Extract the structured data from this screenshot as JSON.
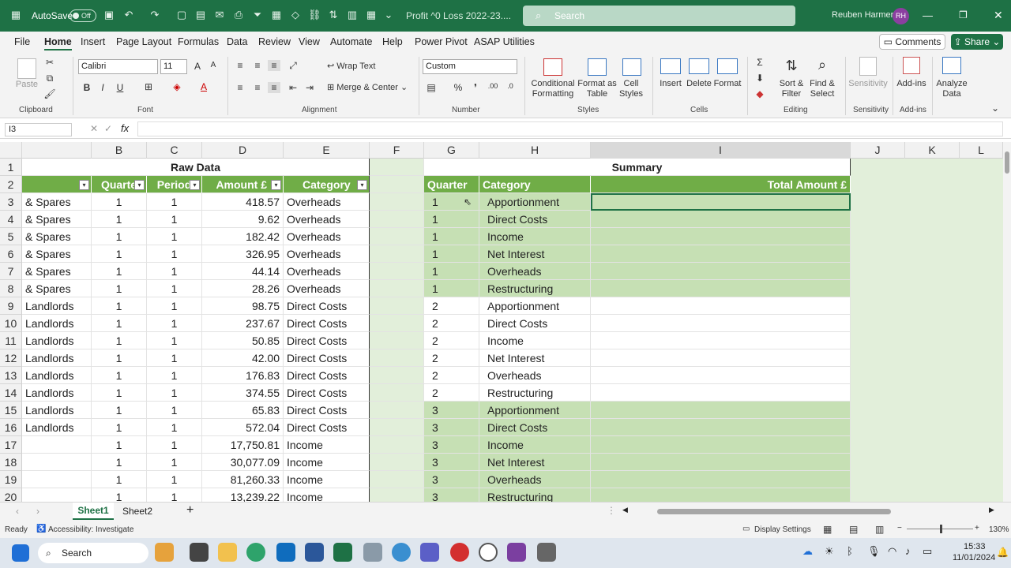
{
  "titlebar": {
    "autosave": "AutoSave",
    "toggle": "Off",
    "filename": "Profit ^0 Loss 2022-23....",
    "search_placeholder": "Search",
    "user": "Reuben Harmer",
    "initials": "RH"
  },
  "menu": [
    "File",
    "Home",
    "Insert",
    "Page Layout",
    "Formulas",
    "Data",
    "Review",
    "View",
    "Automate",
    "Help",
    "Power Pivot",
    "ASAP Utilities"
  ],
  "buttons": {
    "comments": "Comments",
    "share": "Share"
  },
  "ribbon": {
    "clipboard": {
      "paste": "Paste",
      "group": "Clipboard"
    },
    "font": {
      "name": "Calibri",
      "size": "11",
      "group": "Font"
    },
    "alignment": {
      "wrap": "Wrap Text",
      "merge": "Merge & Center",
      "group": "Alignment"
    },
    "number": {
      "format": "Custom",
      "group": "Number"
    },
    "styles": {
      "cond": "Conditional Formatting",
      "table": "Format as Table",
      "cell": "Cell Styles",
      "group": "Styles"
    },
    "cells": {
      "insert": "Insert",
      "delete": "Delete",
      "format": "Format",
      "group": "Cells"
    },
    "editing": {
      "sort": "Sort & Filter",
      "find": "Find & Select",
      "group": "Editing"
    },
    "sensitivity": {
      "label": "Sensitivity",
      "group": "Sensitivity"
    },
    "addins": {
      "label": "Add-ins",
      "group": "Add-ins"
    },
    "analyze": {
      "label": "Analyze Data"
    }
  },
  "namebox": "I3",
  "fx": "fx",
  "columns": [
    "B",
    "C",
    "D",
    "E",
    "F",
    "G",
    "H",
    "I",
    "J",
    "K",
    "L"
  ],
  "raw": {
    "title": "Raw Data",
    "headers": [
      "Quarte",
      "Period",
      "Amount £",
      "Category"
    ],
    "rows": [
      [
        "& Spares",
        "1",
        "1",
        "418.57",
        "Overheads"
      ],
      [
        "& Spares",
        "1",
        "1",
        "9.62",
        "Overheads"
      ],
      [
        "& Spares",
        "1",
        "1",
        "182.42",
        "Overheads"
      ],
      [
        "& Spares",
        "1",
        "1",
        "326.95",
        "Overheads"
      ],
      [
        "& Spares",
        "1",
        "1",
        "44.14",
        "Overheads"
      ],
      [
        "& Spares",
        "1",
        "1",
        "28.26",
        "Overheads"
      ],
      [
        "Landlords",
        "1",
        "1",
        "98.75",
        "Direct Costs"
      ],
      [
        "Landlords",
        "1",
        "1",
        "237.67",
        "Direct Costs"
      ],
      [
        "Landlords",
        "1",
        "1",
        "50.85",
        "Direct Costs"
      ],
      [
        "Landlords",
        "1",
        "1",
        "42.00",
        "Direct Costs"
      ],
      [
        "Landlords",
        "1",
        "1",
        "176.83",
        "Direct Costs"
      ],
      [
        "Landlords",
        "1",
        "1",
        "374.55",
        "Direct Costs"
      ],
      [
        "Landlords",
        "1",
        "1",
        "65.83",
        "Direct Costs"
      ],
      [
        "Landlords",
        "1",
        "1",
        "572.04",
        "Direct Costs"
      ],
      [
        "",
        "1",
        "1",
        "17,750.81",
        "Income"
      ],
      [
        "",
        "1",
        "1",
        "30,077.09",
        "Income"
      ],
      [
        "",
        "1",
        "1",
        "81,260.33",
        "Income"
      ],
      [
        "",
        "1",
        "1",
        "13,239.22",
        "Income"
      ]
    ]
  },
  "summary": {
    "title": "Summary",
    "headers": [
      "Quarter",
      "Category",
      "Total Amount £"
    ],
    "rows": [
      [
        "1",
        "Apportionment"
      ],
      [
        "1",
        "Direct Costs"
      ],
      [
        "1",
        "Income"
      ],
      [
        "1",
        "Net Interest"
      ],
      [
        "1",
        "Overheads"
      ],
      [
        "1",
        "Restructuring"
      ],
      [
        "2",
        "Apportionment"
      ],
      [
        "2",
        "Direct Costs"
      ],
      [
        "2",
        "Income"
      ],
      [
        "2",
        "Net Interest"
      ],
      [
        "2",
        "Overheads"
      ],
      [
        "2",
        "Restructuring"
      ],
      [
        "3",
        "Apportionment"
      ],
      [
        "3",
        "Direct Costs"
      ],
      [
        "3",
        "Income"
      ],
      [
        "3",
        "Net Interest"
      ],
      [
        "3",
        "Overheads"
      ],
      [
        "3",
        "Restructuring"
      ]
    ]
  },
  "row_numbers": [
    "1",
    "2",
    "3",
    "4",
    "5",
    "6",
    "7",
    "8",
    "9",
    "10",
    "11",
    "12",
    "13",
    "14",
    "15",
    "16",
    "17",
    "18",
    "19",
    "20"
  ],
  "sheets": [
    "Sheet1",
    "Sheet2"
  ],
  "status": {
    "ready": "Ready",
    "accessibility": "Accessibility: Investigate",
    "display": "Display Settings",
    "zoom": "130%"
  },
  "taskbar": {
    "search": "Search",
    "time": "15:33",
    "date": "11/01/2024"
  },
  "colors": {
    "excel_green": "#1e7145",
    "table_header": "#70ad47",
    "band_light": "#c6e0b4",
    "sheet_bg": "#e2efda"
  }
}
